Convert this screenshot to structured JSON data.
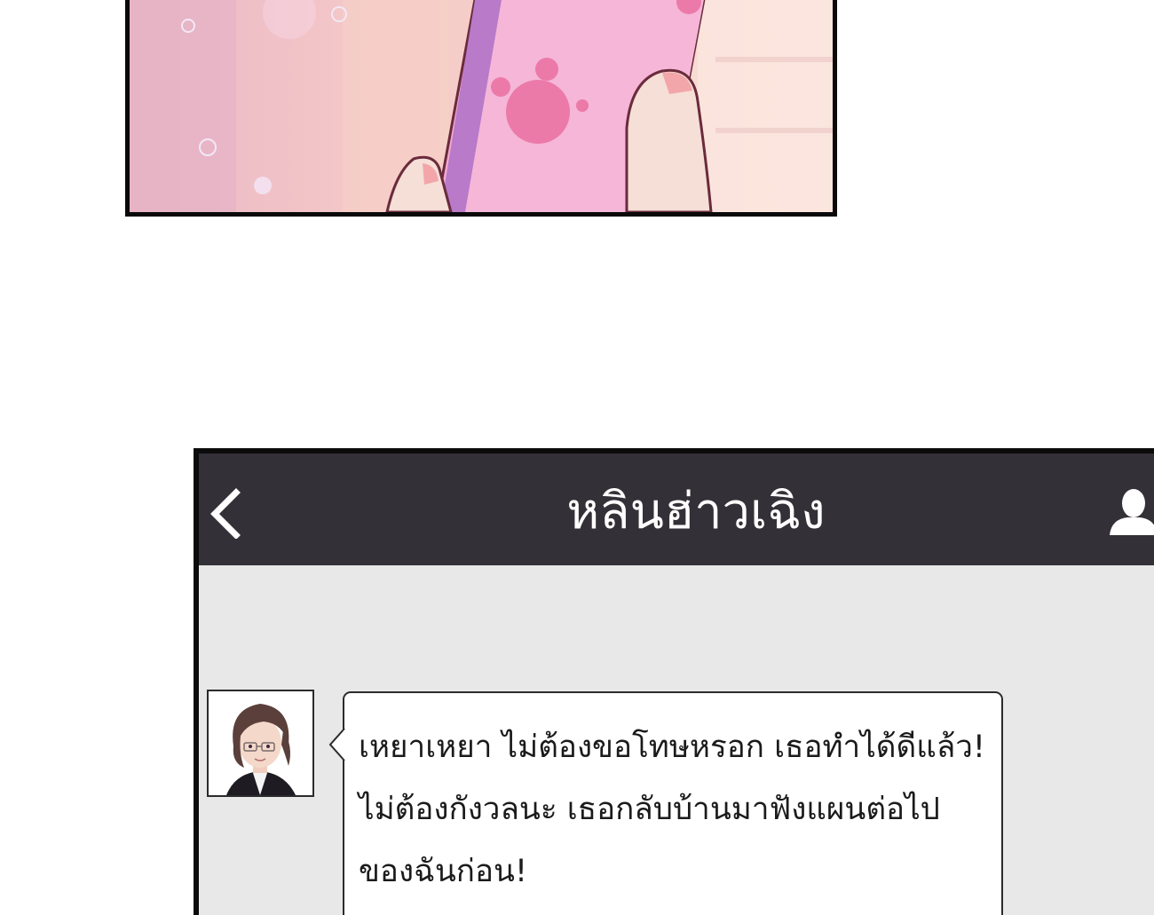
{
  "chat": {
    "title": "หลินฮ่าวเฉิง",
    "back_icon": "chevron-left-icon",
    "profile_icon": "user-icon",
    "header_bg": "#343037",
    "body_bg": "#e8e8e8",
    "messages": [
      {
        "sender": "incoming",
        "lines": [
          "เหยาเหยา ไม่ต้องขอโทษหรอก เธอทำได้ดีแล้ว!",
          "ไม่ต้องกังวลนะ เธอกลับบ้านมาฟังแผนต่อไป",
          "ของฉันก่อน!"
        ]
      }
    ]
  }
}
